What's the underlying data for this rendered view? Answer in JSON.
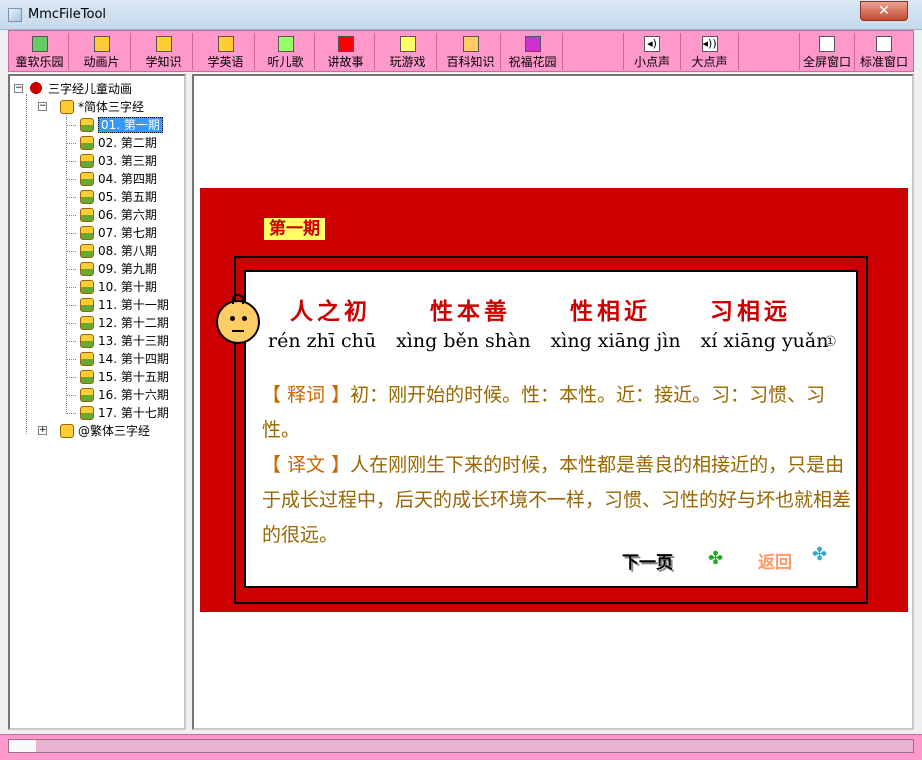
{
  "window": {
    "title": "MmcFileTool",
    "close_label": "✕"
  },
  "toolbar": [
    {
      "label": "童软乐园",
      "icon": "kids-park-icon",
      "color": "#66cc66"
    },
    {
      "label": "动画片",
      "icon": "cartoon-icon",
      "color": "#ffcc33"
    },
    {
      "label": "学知识",
      "icon": "knowledge-icon",
      "color": "#ffcc33"
    },
    {
      "label": "学英语",
      "icon": "english-icon",
      "color": "#ffcc33"
    },
    {
      "label": "听儿歌",
      "icon": "songs-icon",
      "color": "#99ff66"
    },
    {
      "label": "讲故事",
      "icon": "story-icon",
      "color": "#ff0000"
    },
    {
      "label": "玩游戏",
      "icon": "game-icon",
      "color": "#ffff66"
    },
    {
      "label": "百科知识",
      "icon": "encyclopedia-icon",
      "color": "#ffcc66"
    },
    {
      "label": "祝福花园",
      "icon": "garden-icon",
      "color": "#cc33cc"
    },
    {
      "label": "小点声",
      "icon": "volume-down-icon",
      "color": "#ffffff"
    },
    {
      "label": "大点声",
      "icon": "volume-up-icon",
      "color": "#ffffff"
    },
    {
      "label": "全屏窗口",
      "icon": "fullscreen-icon",
      "color": "#ffffff"
    },
    {
      "label": "标准窗口",
      "icon": "normal-window-icon",
      "color": "#ffffff"
    }
  ],
  "tree": {
    "root": "三字经儿童动画",
    "group1": "*简体三字经",
    "items": [
      "01. 第一期",
      "02. 第二期",
      "03. 第三期",
      "04. 第四期",
      "05. 第五期",
      "06. 第六期",
      "07. 第七期",
      "08. 第八期",
      "09. 第九期",
      "10. 第十期",
      "11. 第十一期",
      "12. 第十二期",
      "13. 第十三期",
      "14. 第十四期",
      "15. 第十五期",
      "16. 第十六期",
      "17. 第十七期"
    ],
    "group2": "@繁体三字经",
    "expand_minus": "−",
    "expand_plus": "+"
  },
  "lesson": {
    "episode": "第一期",
    "hanzi": [
      "人之初",
      "性本善",
      "性相近",
      "习相远"
    ],
    "pinyin": [
      "rén zhī chū",
      "xìng běn shàn",
      "xìng xiāng jìn",
      "xí xiāng yuǎn"
    ],
    "marker": "①",
    "shici_tag": "【 释词 】",
    "shici_text": "初：刚开始的时候。性：本性。近：接近。习：习惯、习性。",
    "yiwen_tag": "【 译文 】",
    "yiwen_text": "人在刚刚生下来的时候，本性都是善良的相接近的，只是由于成长过程中，后天的成长环境不一样，习惯、习性的好与坏也就相差的很远。",
    "next_label": "下一页",
    "back_label": "返回"
  },
  "status": {
    "progress": 0.03
  }
}
